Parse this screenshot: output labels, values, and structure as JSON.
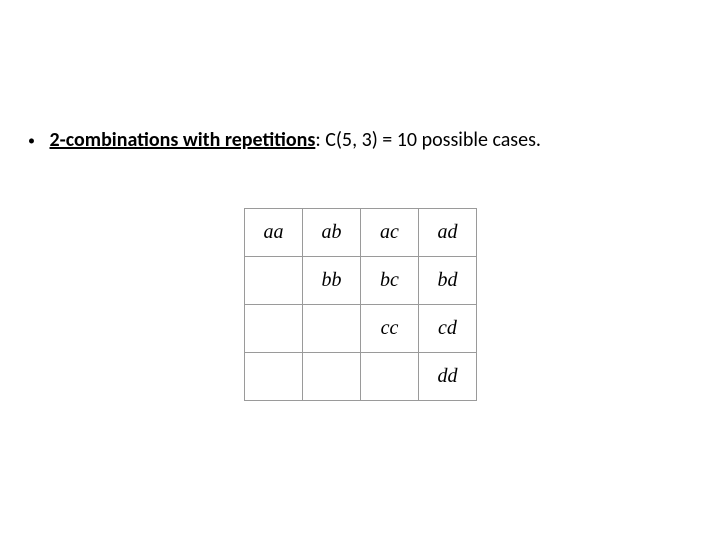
{
  "bullet": {
    "bold_part": "2-combinations with  repetitions",
    "rest_part": ": C(5, 3) = 10 possible cases."
  },
  "table": {
    "rows": [
      [
        "aa",
        "ab",
        "ac",
        "ad"
      ],
      [
        "",
        "bb",
        "bc",
        "bd"
      ],
      [
        "",
        "",
        "cc",
        "cd"
      ],
      [
        "",
        "",
        "",
        "dd"
      ]
    ]
  }
}
